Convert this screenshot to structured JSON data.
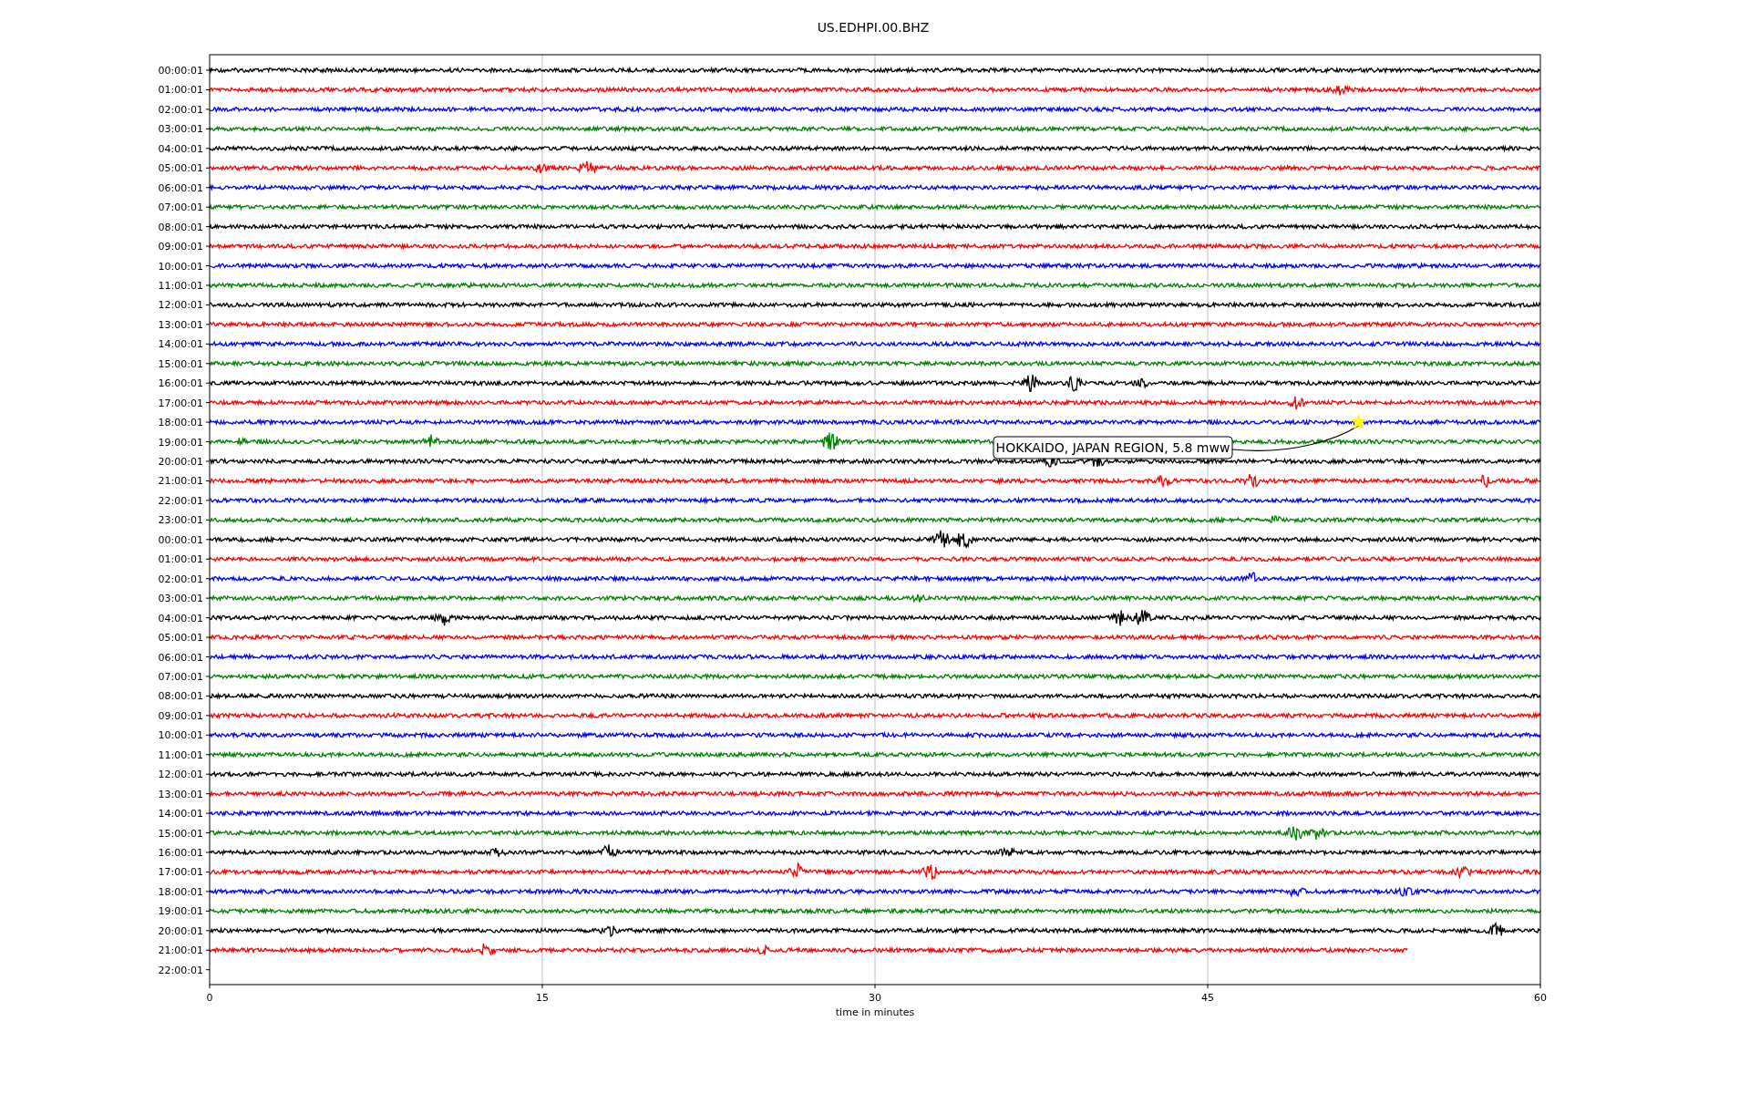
{
  "title": "US.EDHPI.00.BHZ",
  "rows": [
    {
      "label": "00:00:01",
      "color": "#000000",
      "kind": "full"
    },
    {
      "label": "01:00:01",
      "color": "#ff0000",
      "kind": "full"
    },
    {
      "label": "02:00:01",
      "color": "#0000ff",
      "kind": "full"
    },
    {
      "label": "03:00:01",
      "color": "#008000",
      "kind": "full"
    },
    {
      "label": "04:00:01",
      "color": "#000000",
      "kind": "full"
    },
    {
      "label": "05:00:01",
      "color": "#ff0000",
      "kind": "full"
    },
    {
      "label": "06:00:01",
      "color": "#0000ff",
      "kind": "full"
    },
    {
      "label": "07:00:01",
      "color": "#008000",
      "kind": "full"
    },
    {
      "label": "08:00:01",
      "color": "#000000",
      "kind": "full"
    },
    {
      "label": "09:00:01",
      "color": "#ff0000",
      "kind": "full"
    },
    {
      "label": "10:00:01",
      "color": "#0000ff",
      "kind": "full"
    },
    {
      "label": "11:00:01",
      "color": "#008000",
      "kind": "full"
    },
    {
      "label": "12:00:01",
      "color": "#000000",
      "kind": "full"
    },
    {
      "label": "13:00:01",
      "color": "#ff0000",
      "kind": "full"
    },
    {
      "label": "14:00:01",
      "color": "#0000ff",
      "kind": "full"
    },
    {
      "label": "15:00:01",
      "color": "#008000",
      "kind": "full"
    },
    {
      "label": "16:00:01",
      "color": "#000000",
      "kind": "full"
    },
    {
      "label": "17:00:01",
      "color": "#ff0000",
      "kind": "full"
    },
    {
      "label": "18:00:01",
      "color": "#0000ff",
      "kind": "full"
    },
    {
      "label": "19:00:01",
      "color": "#008000",
      "kind": "full"
    },
    {
      "label": "20:00:01",
      "color": "#000000",
      "kind": "full"
    },
    {
      "label": "21:00:01",
      "color": "#ff0000",
      "kind": "full"
    },
    {
      "label": "22:00:01",
      "color": "#0000ff",
      "kind": "full"
    },
    {
      "label": "23:00:01",
      "color": "#008000",
      "kind": "full"
    },
    {
      "label": "00:00:01",
      "color": "#000000",
      "kind": "full"
    },
    {
      "label": "01:00:01",
      "color": "#ff0000",
      "kind": "full"
    },
    {
      "label": "02:00:01",
      "color": "#0000ff",
      "kind": "full"
    },
    {
      "label": "03:00:01",
      "color": "#008000",
      "kind": "full"
    },
    {
      "label": "04:00:01",
      "color": "#000000",
      "kind": "full"
    },
    {
      "label": "05:00:01",
      "color": "#ff0000",
      "kind": "full"
    },
    {
      "label": "06:00:01",
      "color": "#0000ff",
      "kind": "full"
    },
    {
      "label": "07:00:01",
      "color": "#008000",
      "kind": "full"
    },
    {
      "label": "08:00:01",
      "color": "#000000",
      "kind": "full"
    },
    {
      "label": "09:00:01",
      "color": "#ff0000",
      "kind": "full"
    },
    {
      "label": "10:00:01",
      "color": "#0000ff",
      "kind": "full"
    },
    {
      "label": "11:00:01",
      "color": "#008000",
      "kind": "full"
    },
    {
      "label": "12:00:01",
      "color": "#000000",
      "kind": "full"
    },
    {
      "label": "13:00:01",
      "color": "#ff0000",
      "kind": "full"
    },
    {
      "label": "14:00:01",
      "color": "#0000ff",
      "kind": "full"
    },
    {
      "label": "15:00:01",
      "color": "#008000",
      "kind": "full"
    },
    {
      "label": "16:00:01",
      "color": "#000000",
      "kind": "full"
    },
    {
      "label": "17:00:01",
      "color": "#ff0000",
      "kind": "full"
    },
    {
      "label": "18:00:01",
      "color": "#0000ff",
      "kind": "full"
    },
    {
      "label": "19:00:01",
      "color": "#008000",
      "kind": "full"
    },
    {
      "label": "20:00:01",
      "color": "#000000",
      "kind": "full"
    },
    {
      "label": "21:00:01",
      "color": "#ff0000",
      "kind": "partial"
    },
    {
      "label": "22:00:01",
      "kind": "none"
    }
  ],
  "x_ticks": [
    "0",
    "15",
    "30",
    "45",
    "60"
  ],
  "xlabel": "time in minutes",
  "annotation": "HOKKAIDO, JAPAN REGION, 5.8 mww"
}
